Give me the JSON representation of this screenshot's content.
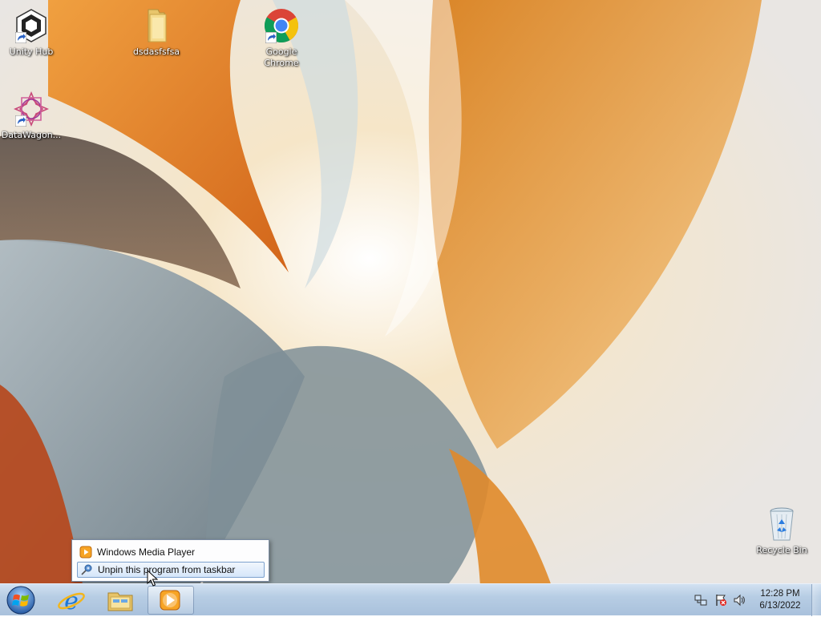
{
  "desktop": {
    "icons": [
      {
        "label": "Unity Hub",
        "icon": "unity-hub-icon"
      },
      {
        "label": "dsdasfsfsa",
        "icon": "folder-icon"
      },
      {
        "label": "Google Chrome",
        "icon": "chrome-icon"
      },
      {
        "label": "DataWagon...",
        "icon": "datawagon-icon"
      },
      {
        "label": "Recycle Bin",
        "icon": "recycle-bin-icon"
      }
    ]
  },
  "jump_list": {
    "items": [
      {
        "label": "Windows Media Player",
        "icon": "media-player-icon"
      },
      {
        "label": "Unpin this program from taskbar",
        "icon": "unpin-icon",
        "highlighted": true
      }
    ]
  },
  "taskbar": {
    "pinned": [
      "start-orb-icon",
      "internet-explorer-icon",
      "windows-explorer-icon",
      "media-player-icon"
    ],
    "tray": {
      "icons": [
        "network-icon",
        "action-center-icon",
        "volume-icon"
      ],
      "time": "12:28 PM",
      "date": "6/13/2022"
    }
  },
  "colors": {
    "accent": "#e07a1e",
    "highlight_border": "#7da2ce",
    "taskbar": "#b7cde4"
  }
}
